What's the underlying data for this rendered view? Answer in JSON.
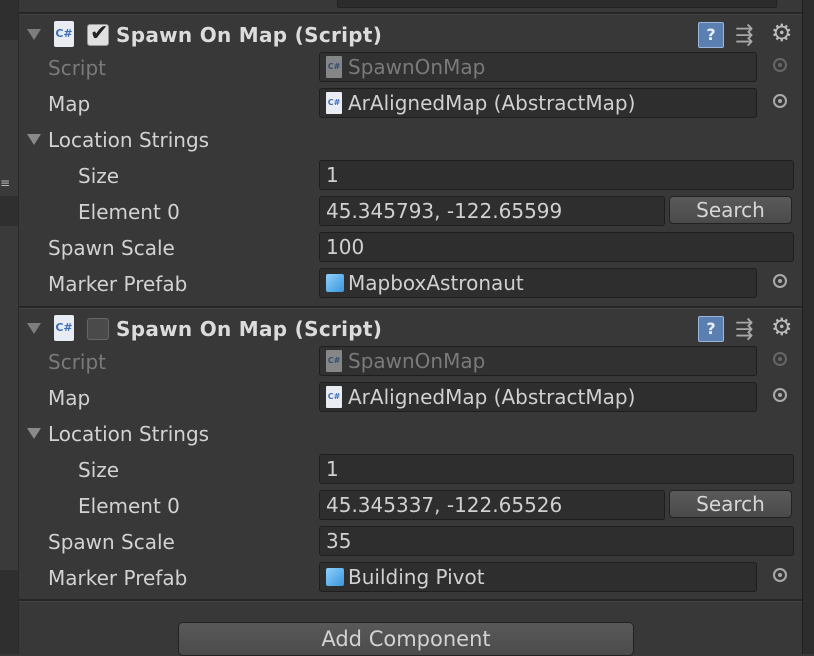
{
  "components": [
    {
      "title": "Spawn On Map (Script)",
      "enabled": true,
      "icon": "csharp-script-icon",
      "script_label": "Script",
      "script_value": "SpawnOnMap",
      "map_label": "Map",
      "map_value": "ArAlignedMap (AbstractMap)",
      "location_label": "Location Strings",
      "size_label": "Size",
      "size_value": "1",
      "element_label": "Element 0",
      "element_value": "45.345793, -122.65599",
      "search_label": "Search",
      "spawn_scale_label": "Spawn Scale",
      "spawn_scale_value": "100",
      "marker_label": "Marker Prefab",
      "marker_value": "MapboxAstronaut"
    },
    {
      "title": "Spawn On Map (Script)",
      "enabled": false,
      "icon": "csharp-script-icon",
      "script_label": "Script",
      "script_value": "SpawnOnMap",
      "map_label": "Map",
      "map_value": "ArAlignedMap (AbstractMap)",
      "location_label": "Location Strings",
      "size_label": "Size",
      "size_value": "1",
      "element_label": "Element 0",
      "element_value": "45.345337, -122.65526",
      "search_label": "Search",
      "spawn_scale_label": "Spawn Scale",
      "spawn_scale_value": "35",
      "marker_label": "Marker Prefab",
      "marker_value": "Building Pivot"
    }
  ],
  "add_component_label": "Add Component",
  "icons": {
    "help": "help-book-icon",
    "presets": "presets-sliders-icon",
    "settings": "gear-icon",
    "object_picker": "object-picker-icon",
    "prefab": "prefab-cube-icon"
  },
  "colors": {
    "background": "#383838",
    "field": "#2e2e2e",
    "text": "#d2d2d2",
    "dim_text": "#7a7a7a"
  }
}
